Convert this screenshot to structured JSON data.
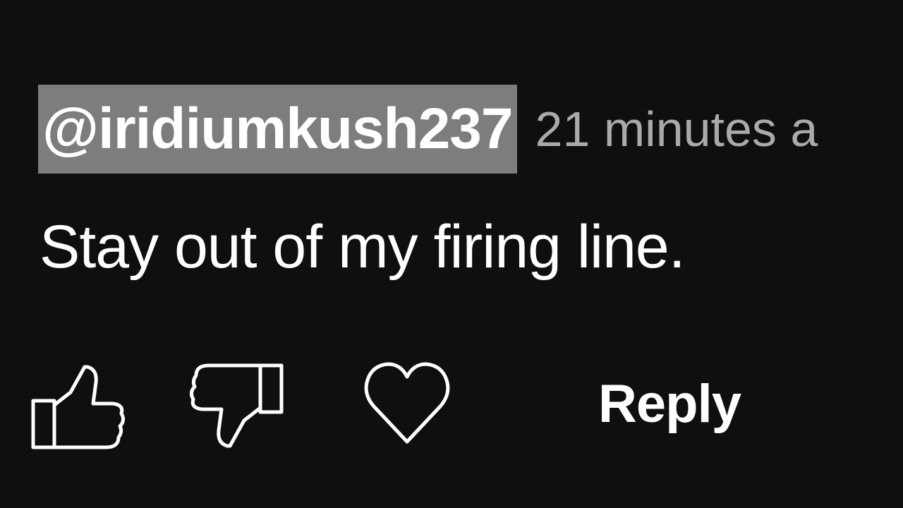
{
  "comment": {
    "author": "@iridiumkush237",
    "timestamp": "21 minutes a",
    "text": "Stay out of my firing line."
  },
  "actions": {
    "like_icon": "thumbs-up-icon",
    "dislike_icon": "thumbs-down-icon",
    "heart_icon": "heart-icon",
    "reply_label": "Reply"
  },
  "colors": {
    "background": "#0f0f0f",
    "author_highlight": "#7d7d7d",
    "timestamp": "#aaaaaa",
    "text": "#ffffff"
  }
}
